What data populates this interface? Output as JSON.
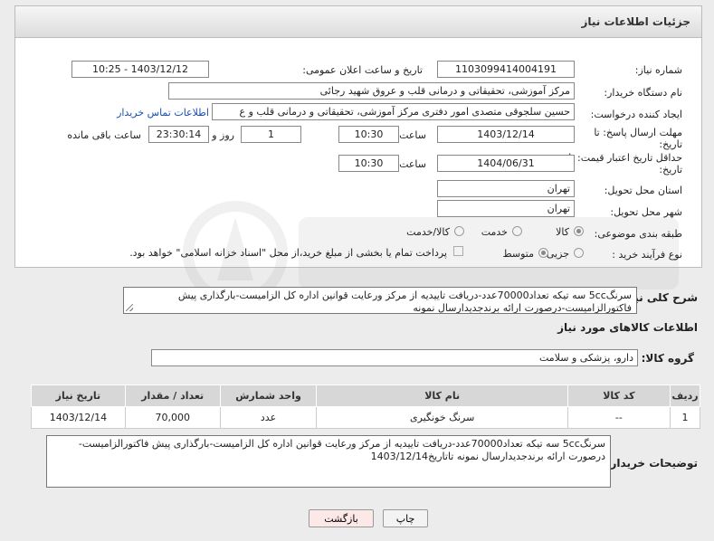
{
  "title": "جزئیات اطلاعات نیاز",
  "fields": {
    "need_number_label": "شماره نیاز:",
    "need_number": "1103099414004191",
    "announce_label": "تاریخ و ساعت اعلان عمومی:",
    "announce_value": "1403/12/12 - 10:25",
    "buyer_org_label": "نام دستگاه خریدار:",
    "buyer_org": "مرکز آموزشی، تحقیقاتی و درمانی قلب و عروق شهید رجائی",
    "creator_label": "ایجاد کننده درخواست:",
    "creator": "حسین سلجوقی متصدی امور دفتری مرکز آموزشی، تحقیقاتی و درمانی قلب و ع",
    "contact_link": "اطلاعات تماس خریدار",
    "deadline_label": "مهلت ارسال پاسخ: تا",
    "date_suffix": "تاریخ:",
    "deadline_date": "1403/12/14",
    "time_label": "ساعت",
    "deadline_time": "10:30",
    "days_value": "1",
    "days_label": "روز و",
    "remaining_time": "23:30:14",
    "remaining_label": "ساعت باقی مانده",
    "validity_label": "حداقل تاریخ اعتبار قیمت: تا",
    "validity_date": "1404/06/31",
    "validity_time": "10:30",
    "province_label": "استان محل تحویل:",
    "province": "تهران",
    "city_label": "شهر محل تحویل:",
    "city": "تهران",
    "category_label": "طبقه بندی موضوعی:",
    "category_options": [
      "کالا",
      "خدمت",
      "کالا/خدمت"
    ],
    "process_label": "نوع فرآیند خرید :",
    "process_options": [
      "جزیی",
      "متوسط"
    ],
    "payment_note": "پرداخت تمام یا بخشی از مبلغ خرید،از محل \"اسناد خزانه اسلامی\" خواهد بود."
  },
  "summary": {
    "label": "شرح کلی نیاز:",
    "text": "سرنگ5cc سه تیکه تعداد70000عدد-دریافت تاییدیه از مرکز ورعایت قوانین اداره کل الزامیست-بارگذاری پیش فاکتورالزامیست-درصورت ارائه برندجدیدارسال نمونه"
  },
  "goods": {
    "section_title": "اطلاعات کالاهای مورد نیاز",
    "group_label": "گروه کالا:",
    "group_value": "دارو، پزشکی و سلامت",
    "columns": [
      "ردیف",
      "کد کالا",
      "نام کالا",
      "واحد شمارش",
      "تعداد / مقدار",
      "تاریخ نیاز"
    ],
    "rows": [
      [
        "1",
        "--",
        "سرنگ خونگیری",
        "عدد",
        "70,000",
        "1403/12/14"
      ]
    ]
  },
  "buyer_notes": {
    "label": "توضیحات خریدار:",
    "text": "سرنگ5cc سه تیکه تعداد70000عدد-دریافت تاییدیه از مرکز ورعایت قوانین اداره کل الزامیست-بارگذاری پیش فاکتورالزامیست-درصورت ارائه برندجدیدارسال نمونه تاتاریخ1403/12/14"
  },
  "buttons": {
    "print": "چاپ",
    "back": "بازگشت"
  },
  "colors": {
    "link": "#1a4fb0",
    "back_button_bg": "#fde8e8",
    "header_bg": "#d7d7d7"
  }
}
